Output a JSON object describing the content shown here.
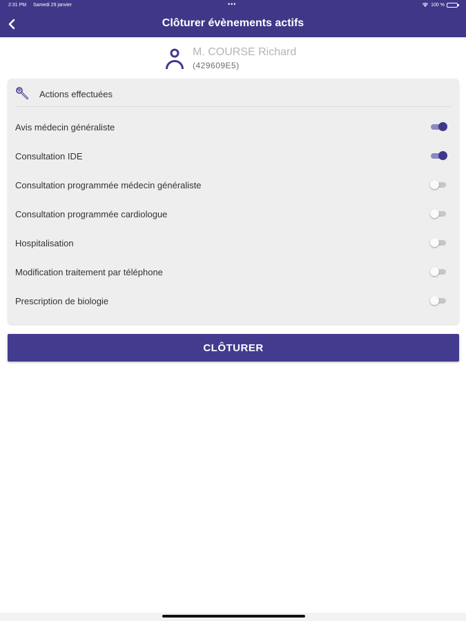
{
  "status_bar": {
    "time": "2:31 PM",
    "date": "Samedi 29 janvier",
    "dots": "•••",
    "battery": "100 %"
  },
  "navbar": {
    "title": "Clôturer évènements actifs",
    "back_icon": "chevron-left-icon"
  },
  "patient": {
    "name": "M. COURSE Richard",
    "id": "(429609E5)",
    "icon": "person-icon"
  },
  "actions_card": {
    "header": "Actions effectuées",
    "icon": "wrench-icon",
    "items": [
      {
        "label": "Avis médecin généraliste",
        "enabled": true
      },
      {
        "label": "Consultation IDE",
        "enabled": true
      },
      {
        "label": "Consultation programmée médecin généraliste",
        "enabled": false
      },
      {
        "label": "Consultation programmée cardiologue",
        "enabled": false
      },
      {
        "label": "Hospitalisation",
        "enabled": false
      },
      {
        "label": "Modification traitement par téléphone",
        "enabled": false
      },
      {
        "label": "Prescription de biologie",
        "enabled": false
      }
    ]
  },
  "submit_button": "CLÔTURER",
  "colors": {
    "primary": "#3f3888",
    "toggle_track_on": "#8d88bf",
    "toggle_track_off": "#c6c6c6",
    "card_background": "#eeeeee"
  }
}
